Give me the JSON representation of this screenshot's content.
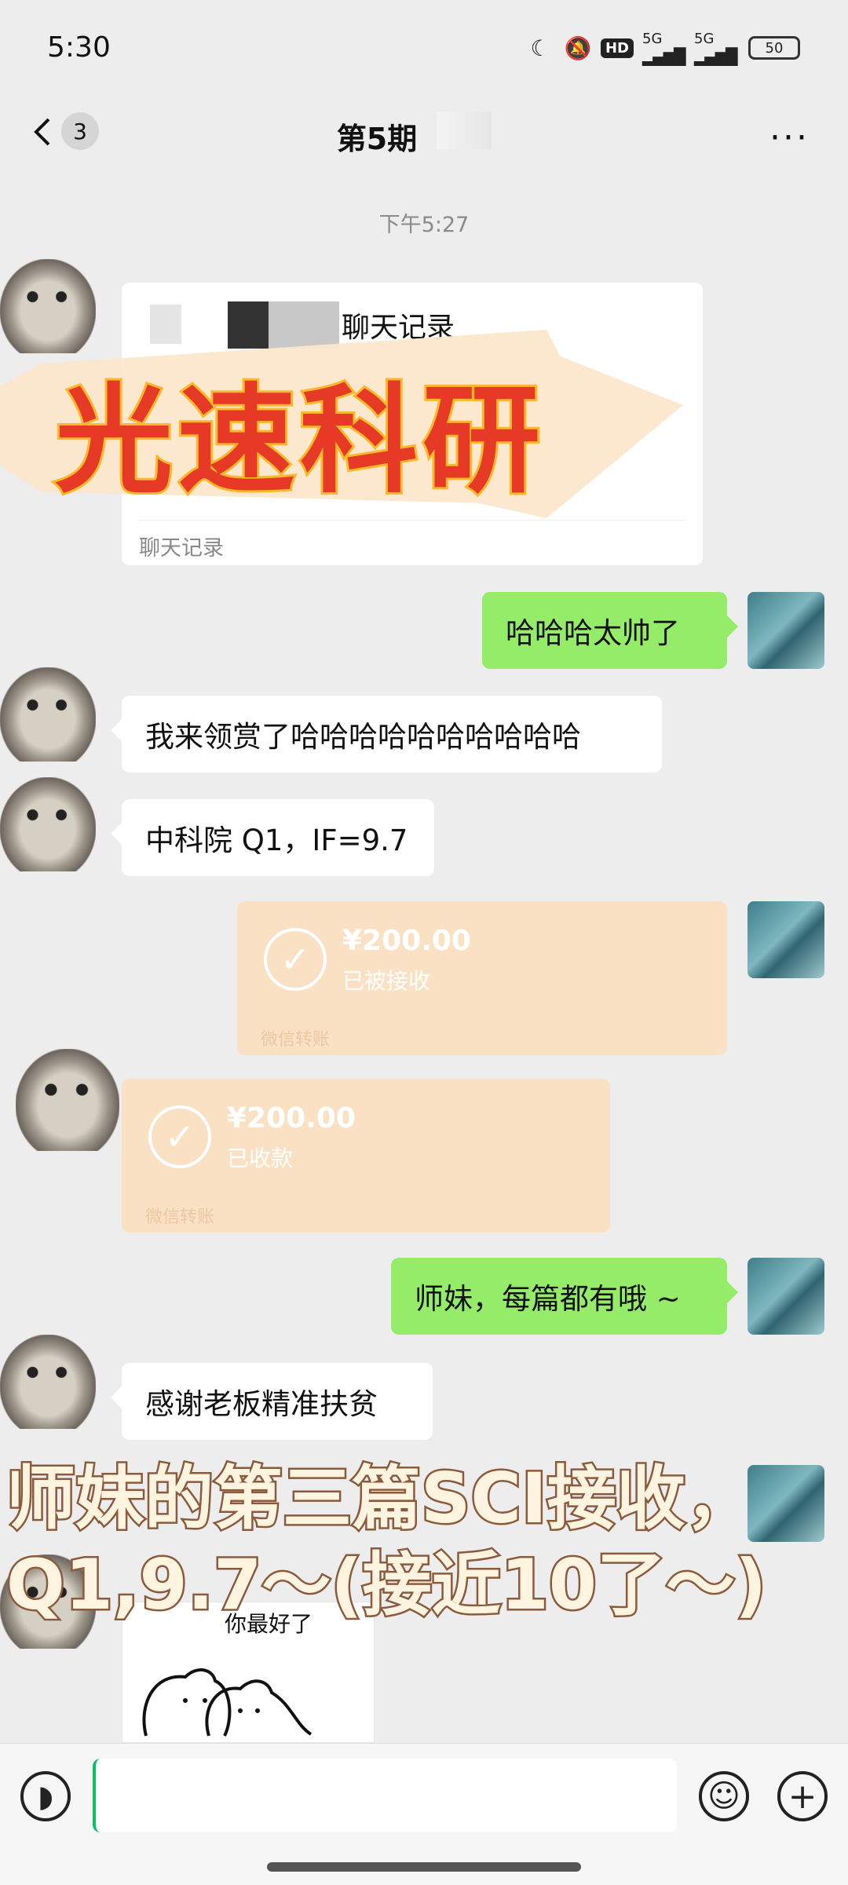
{
  "status_bar": {
    "time": "5:30",
    "network_badge": "HD",
    "signal_1": "5G",
    "signal_2": "5G",
    "battery": "50",
    "icons": [
      "moon-icon",
      "mute-bell-icon",
      "hd-badge",
      "signal-5g-icon",
      "signal-5g-icon",
      "battery-icon"
    ]
  },
  "nav": {
    "back_icon": "chevron-left-icon",
    "unread_count": "3",
    "title": "第5期",
    "more_icon": "ellipsis-icon"
  },
  "timestamp": "下午5:27",
  "messages": {
    "forward_card": {
      "title": "聊天记录",
      "footer": "聊天记录"
    },
    "m1": "哈哈哈太帅了",
    "m2": "我来领赏了哈哈哈哈哈哈哈哈哈哈",
    "m3": "中科院 Q1，IF=9.7",
    "transfer_out": {
      "amount": "¥200.00",
      "status": "已被接收",
      "footer": "微信转账"
    },
    "transfer_in": {
      "amount": "¥200.00",
      "status": "已收款",
      "footer": "微信转账"
    },
    "m4": "师妹，每篇都有哦 ~",
    "m5": "感谢老板精准扶贫",
    "sticker_text": "你最好了"
  },
  "overlay": {
    "banner": "光速科研",
    "caption_line1": "师妹的第三篇SCI接收，",
    "caption_line2": "Q1,9.7～(接近10了～)"
  },
  "input_bar": {
    "voice_icon": "voice-icon",
    "emoji_icon": "emoji-icon",
    "plus_icon": "plus-icon",
    "placeholder": ""
  },
  "colors": {
    "background": "#ededed",
    "my_bubble": "#95ec69",
    "other_bubble": "#ffffff",
    "transfer": "#fbe1c3",
    "banner_text": "#e63a26"
  }
}
